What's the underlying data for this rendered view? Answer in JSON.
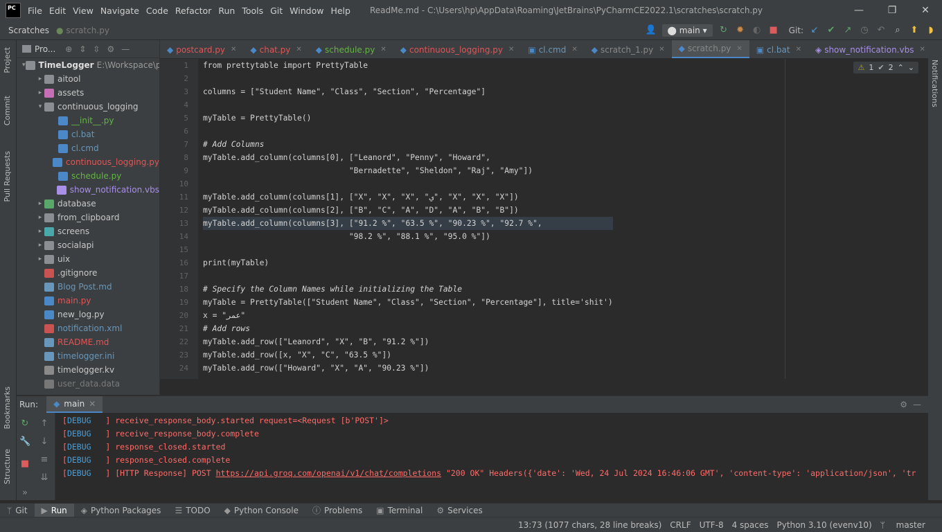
{
  "app": {
    "logo": "PC"
  },
  "menu": [
    "File",
    "Edit",
    "View",
    "Navigate",
    "Code",
    "Refactor",
    "Run",
    "Tools",
    "Git",
    "Window",
    "Help"
  ],
  "window_title": "ReadMe.md - C:\\Users\\hp\\AppData\\Roaming\\JetBrains\\PyCharmCE2022.1\\scratches\\scratch.py",
  "navbar": {
    "crumb": "Scratches",
    "file": "scratch.py",
    "branch": "main",
    "git_label": "Git:"
  },
  "project": {
    "title": "Pro...",
    "root": "TimeLogger",
    "root_path": "E:\\Workspace\\pro",
    "items": [
      {
        "label": "aitool",
        "depth": 1,
        "kind": "folder",
        "arrow": "▸",
        "color": "#c8c8c8"
      },
      {
        "label": "assets",
        "depth": 1,
        "kind": "folder-pink",
        "arrow": "▸",
        "color": "#c8c8c8"
      },
      {
        "label": "continuous_logging",
        "depth": 1,
        "kind": "folder",
        "arrow": "▾",
        "color": "#c8c8c8"
      },
      {
        "label": "__init__.py",
        "depth": 2,
        "kind": "py",
        "arrow": "",
        "color": "#62b543"
      },
      {
        "label": "cl.bat",
        "depth": 2,
        "kind": "bat",
        "arrow": "",
        "color": "#6897bb"
      },
      {
        "label": "cl.cmd",
        "depth": 2,
        "kind": "cmd",
        "arrow": "",
        "color": "#6897bb"
      },
      {
        "label": "continuous_logging.py",
        "depth": 2,
        "kind": "py",
        "arrow": "",
        "color": "#e05555"
      },
      {
        "label": "schedule.py",
        "depth": 2,
        "kind": "py",
        "arrow": "",
        "color": "#62b543"
      },
      {
        "label": "show_notification.vbs",
        "depth": 2,
        "kind": "vbs",
        "arrow": "",
        "color": "#a88fe8"
      },
      {
        "label": "database",
        "depth": 1,
        "kind": "folder-green",
        "arrow": "▸",
        "color": "#c8c8c8"
      },
      {
        "label": "from_clipboard",
        "depth": 1,
        "kind": "folder",
        "arrow": "▸",
        "color": "#c8c8c8"
      },
      {
        "label": "screens",
        "depth": 1,
        "kind": "folder-teal",
        "arrow": "▸",
        "color": "#c8c8c8"
      },
      {
        "label": "socialapi",
        "depth": 1,
        "kind": "folder",
        "arrow": "▸",
        "color": "#c8c8c8"
      },
      {
        "label": "uix",
        "depth": 1,
        "kind": "folder",
        "arrow": "▸",
        "color": "#c8c8c8"
      },
      {
        "label": ".gitignore",
        "depth": 1,
        "kind": "git",
        "arrow": "",
        "color": "#c8c8c8"
      },
      {
        "label": "Blog Post.md",
        "depth": 1,
        "kind": "md",
        "arrow": "",
        "color": "#6897bb"
      },
      {
        "label": "main.py",
        "depth": 1,
        "kind": "py",
        "arrow": "",
        "color": "#e05555"
      },
      {
        "label": "new_log.py",
        "depth": 1,
        "kind": "py",
        "arrow": "",
        "color": "#c8c8c8"
      },
      {
        "label": "notification.xml",
        "depth": 1,
        "kind": "xml",
        "arrow": "",
        "color": "#6897bb"
      },
      {
        "label": "README.md",
        "depth": 1,
        "kind": "md",
        "arrow": "",
        "color": "#e05555"
      },
      {
        "label": "timelogger.ini",
        "depth": 1,
        "kind": "ini",
        "arrow": "",
        "color": "#6897bb"
      },
      {
        "label": "timelogger.kv",
        "depth": 1,
        "kind": "kv",
        "arrow": "",
        "color": "#c8c8c8"
      },
      {
        "label": "user_data.data",
        "depth": 1,
        "kind": "data",
        "arrow": "",
        "color": "#7a7a7a"
      }
    ]
  },
  "tabs": [
    {
      "label": "postcard.py",
      "kind": "py",
      "color": "#e05555"
    },
    {
      "label": "chat.py",
      "kind": "py",
      "color": "#e05555"
    },
    {
      "label": "schedule.py",
      "kind": "py",
      "color": "#62b543"
    },
    {
      "label": "continuous_logging.py",
      "kind": "py",
      "color": "#e05555"
    },
    {
      "label": "cl.cmd",
      "kind": "cmd",
      "color": "#6897bb"
    },
    {
      "label": "scratch_1.py",
      "kind": "py",
      "color": "#888888"
    },
    {
      "label": "scratch.py",
      "kind": "py",
      "color": "#888888",
      "active": true
    },
    {
      "label": "cl.bat",
      "kind": "bat",
      "color": "#6897bb"
    },
    {
      "label": "show_notification.vbs",
      "kind": "vbs",
      "color": "#a88fe8"
    }
  ],
  "editor": {
    "warnings": "1",
    "weak_warnings": "2",
    "lines": [
      "from prettytable import PrettyTable",
      "",
      "columns = [\"Student Name\", \"Class\", \"Section\", \"Percentage\"]",
      "",
      "myTable = PrettyTable()",
      "",
      "# Add Columns",
      "myTable.add_column(columns[0], [\"Leanord\", \"Penny\", \"Howard\",",
      "                               \"Bernadette\", \"Sheldon\", \"Raj\", \"Amy\"])",
      "",
      "myTable.add_column(columns[1], [\"X\", \"X\", \"X\", \"ي\", \"X\", \"X\", \"X\"])",
      "myTable.add_column(columns[2], [\"B\", \"C\", \"A\", \"D\", \"A\", \"B\", \"B\"])",
      "myTable.add_column(columns[3], [\"91.2 %\", \"63.5 %\", \"90.23 %\", \"92.7 %\",",
      "                               \"98.2 %\", \"88.1 %\", \"95.0 %\"])",
      "",
      "print(myTable)",
      "",
      "# Specify the Column Names while initializing the Table",
      "myTable = PrettyTable([\"Student Name\", \"Class\", \"Section\", \"Percentage\"], title='shit')",
      "x = \"عمر\"",
      "# Add rows",
      "myTable.add_row([\"Leanord\", \"X\", \"B\", \"91.2 %\"])",
      "myTable.add_row([x, \"X\", \"C\", \"63.5 %\"])",
      "myTable.add_row([\"Howard\", \"X\", \"A\", \"90.23 %\"])"
    ],
    "line_numbers": [
      "1",
      "2",
      "3",
      "4",
      "5",
      "6",
      "7",
      "8",
      "9",
      "10",
      "11",
      "12",
      "13",
      "14",
      "15",
      "16",
      "17",
      "18",
      "19",
      "20",
      "21",
      "22",
      "23",
      "24"
    ],
    "current_line": 13
  },
  "run": {
    "label": "Run:",
    "tab": "main",
    "console": [
      {
        "level": "DEBUG",
        "msg": "receive_response_body.started request=<Request [b'POST']>",
        "url": "",
        "rest": ""
      },
      {
        "level": "DEBUG",
        "msg": "receive_response_body.complete",
        "url": "",
        "rest": ""
      },
      {
        "level": "DEBUG",
        "msg": "response_closed.started",
        "url": "",
        "rest": ""
      },
      {
        "level": "DEBUG",
        "msg": "response_closed.complete",
        "url": "",
        "rest": ""
      },
      {
        "level": "DEBUG",
        "msg": "[HTTP Response] POST ",
        "url": "https://api.groq.com/openai/v1/chat/completions",
        "rest": " \"200 OK\" Headers({'date': 'Wed, 24 Jul 2024 16:46:06 GMT', 'content-type': 'application/json', 'tr"
      }
    ]
  },
  "side_tabs": {
    "left_top": [
      "Project",
      "Commit",
      "Pull Requests"
    ],
    "left_bottom": [
      "Bookmarks",
      "Structure"
    ],
    "right": [
      "Notifications"
    ]
  },
  "bottom_tabs": [
    "Git",
    "Run",
    "Python Packages",
    "TODO",
    "Python Console",
    "Problems",
    "Terminal",
    "Services"
  ],
  "status": {
    "position": "13:73 (1077 chars, 28 line breaks)",
    "line_sep": "CRLF",
    "encoding": "UTF-8",
    "indent": "4 spaces",
    "interpreter": "Python 3.10 (evenv10)",
    "branch": "master"
  }
}
